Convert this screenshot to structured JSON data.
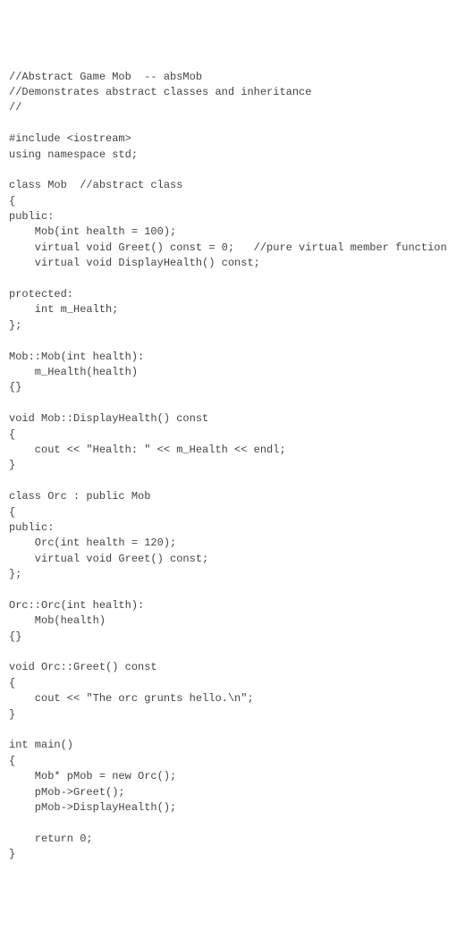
{
  "code": {
    "lines": [
      "//Abstract Game Mob  -- absMob",
      "//Demonstrates abstract classes and inheritance",
      "//",
      "",
      "#include <iostream>",
      "using namespace std;",
      "",
      "class Mob  //abstract class",
      "{",
      "public:",
      "    Mob(int health = 100);",
      "    virtual void Greet() const = 0;   //pure virtual member function",
      "    virtual void DisplayHealth() const;",
      "",
      "protected:",
      "    int m_Health;",
      "};",
      "",
      "Mob::Mob(int health):",
      "    m_Health(health)",
      "{}",
      "",
      "void Mob::DisplayHealth() const",
      "{",
      "    cout << \"Health: \" << m_Health << endl;",
      "}",
      "",
      "class Orc : public Mob",
      "{",
      "public:",
      "    Orc(int health = 120);",
      "    virtual void Greet() const;",
      "};",
      "",
      "Orc::Orc(int health):",
      "    Mob(health)",
      "{}",
      "",
      "void Orc::Greet() const",
      "{",
      "    cout << \"The orc grunts hello.\\n\";",
      "}",
      "",
      "int main()",
      "{",
      "    Mob* pMob = new Orc();",
      "    pMob->Greet();",
      "    pMob->DisplayHealth();",
      "",
      "    return 0;",
      "}"
    ]
  }
}
